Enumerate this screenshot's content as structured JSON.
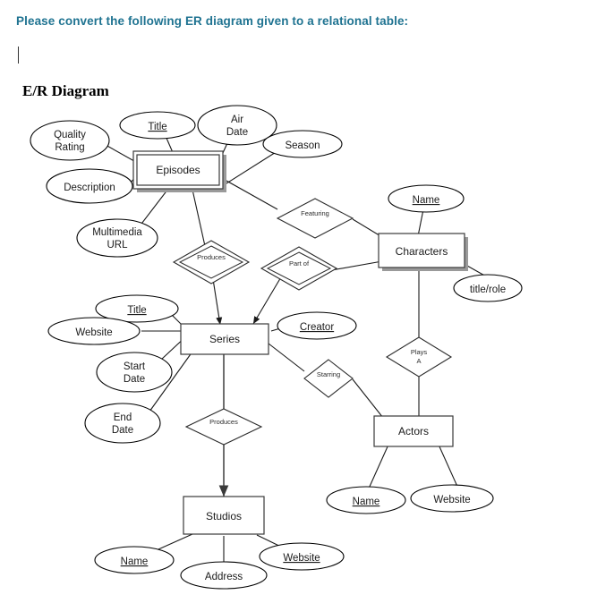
{
  "prompt": {
    "text": "Please convert the following ER diagram given to a relational table:",
    "color": "#1F7391"
  },
  "diagram": {
    "title": "E/R Diagram",
    "entities": [
      {
        "id": "episodes",
        "label": "Episodes",
        "style": "weak-shadow"
      },
      {
        "id": "characters",
        "label": "Characters",
        "style": "shadow"
      },
      {
        "id": "series",
        "label": "Series",
        "style": "plain"
      },
      {
        "id": "actors",
        "label": "Actors",
        "style": "plain"
      },
      {
        "id": "studios",
        "label": "Studios",
        "style": "plain"
      }
    ],
    "relationships": [
      {
        "id": "featuring",
        "label": "Featuring",
        "style": "single"
      },
      {
        "id": "produces-upper",
        "label": "Produces",
        "style": "double"
      },
      {
        "id": "part-of",
        "label": "Part of",
        "style": "double"
      },
      {
        "id": "starring",
        "label": "Starring",
        "style": "single"
      },
      {
        "id": "plays-a-line1",
        "label": "Plays",
        "style": "single"
      },
      {
        "id": "plays-a-line2",
        "label": "A",
        "style": "single"
      },
      {
        "id": "produces-lower",
        "label": "Produces",
        "style": "single"
      }
    ],
    "attributes": [
      {
        "id": "episodes-quality-rating-l1",
        "label": "Quality",
        "key": false
      },
      {
        "id": "episodes-quality-rating-l2",
        "label": "Rating",
        "key": false
      },
      {
        "id": "episodes-title",
        "label": "Title",
        "key": true
      },
      {
        "id": "episodes-air-date-l1",
        "label": "Air",
        "key": false
      },
      {
        "id": "episodes-air-date-l2",
        "label": "Date",
        "key": false
      },
      {
        "id": "episodes-season",
        "label": "Season",
        "key": false
      },
      {
        "id": "episodes-description",
        "label": "Description",
        "key": false
      },
      {
        "id": "episodes-multimedia-l1",
        "label": "Multimedia",
        "key": false
      },
      {
        "id": "episodes-multimedia-l2",
        "label": "URL",
        "key": false
      },
      {
        "id": "characters-name",
        "label": "Name",
        "key": true
      },
      {
        "id": "characters-title-role",
        "label": "title/role",
        "key": false
      },
      {
        "id": "series-title",
        "label": "Title",
        "key": true
      },
      {
        "id": "series-website",
        "label": "Website",
        "key": false
      },
      {
        "id": "series-start-date-l1",
        "label": "Start",
        "key": false
      },
      {
        "id": "series-start-date-l2",
        "label": "Date",
        "key": false
      },
      {
        "id": "series-end-date-l1",
        "label": "End",
        "key": false
      },
      {
        "id": "series-end-date-l2",
        "label": "Date",
        "key": false
      },
      {
        "id": "series-creator",
        "label": "Creator",
        "key": true
      },
      {
        "id": "actors-name",
        "label": "Name",
        "key": true
      },
      {
        "id": "actors-website",
        "label": "Website",
        "key": false
      },
      {
        "id": "studios-name",
        "label": "Name",
        "key": true
      },
      {
        "id": "studios-address",
        "label": "Address",
        "key": false
      },
      {
        "id": "studios-website",
        "label": "Website",
        "key": true
      }
    ]
  }
}
